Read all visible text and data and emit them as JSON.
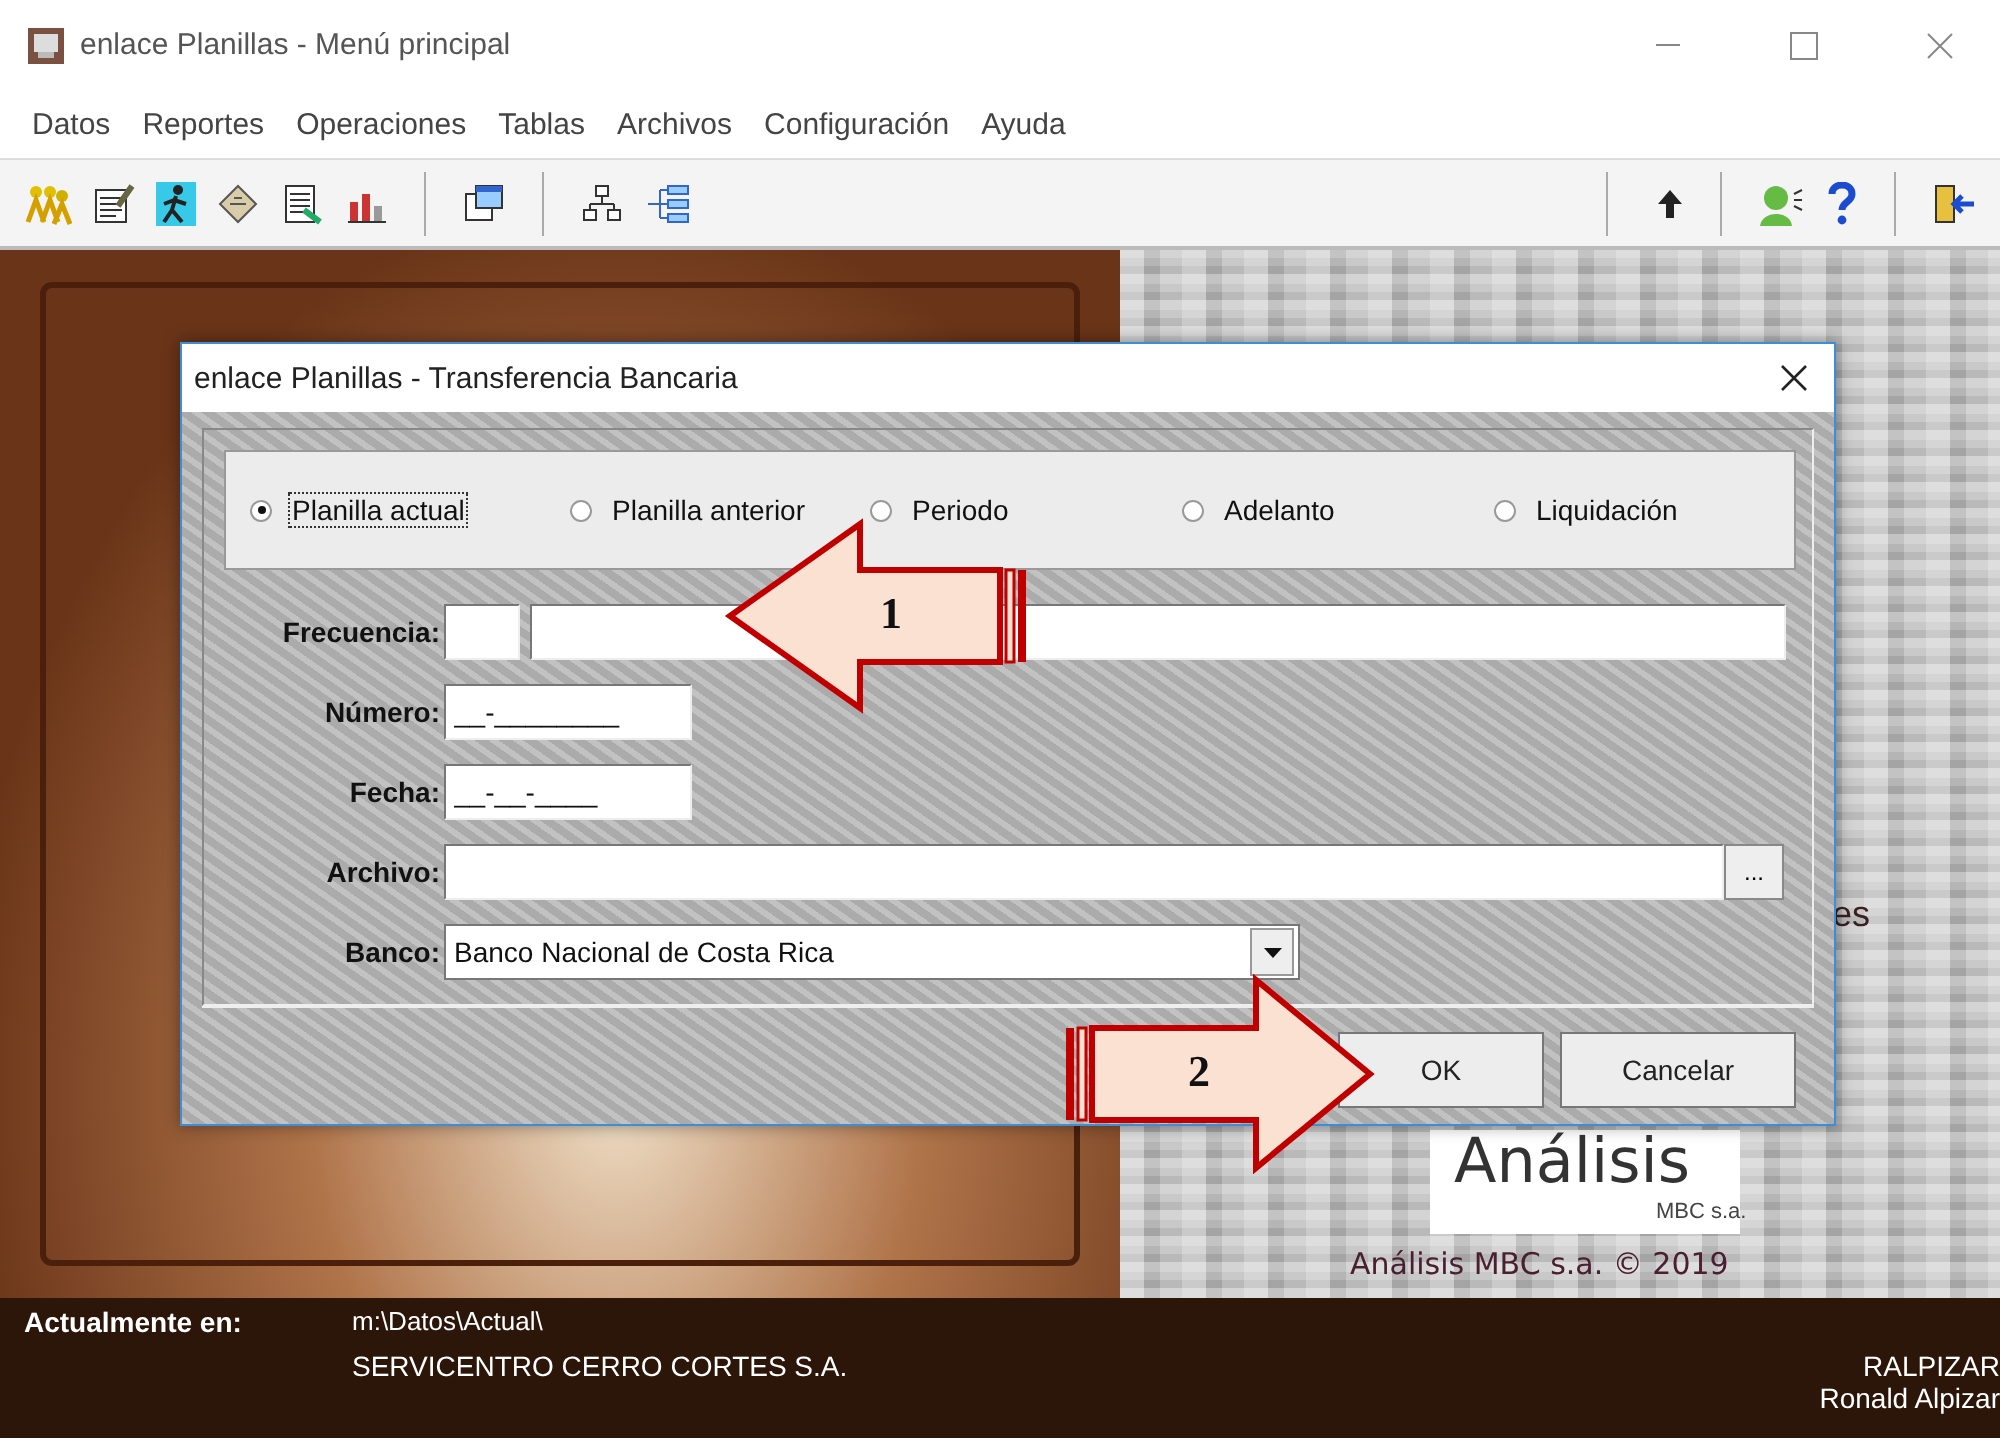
{
  "window": {
    "title": "enlace Planillas - Menú principal"
  },
  "menu": [
    "Datos",
    "Reportes",
    "Operaciones",
    "Tablas",
    "Archivos",
    "Configuración",
    "Ayuda"
  ],
  "background": {
    "fragment": "es",
    "logo_word": "Análisis",
    "logo_sub": "MBC s.a.",
    "copyright": "Análisis MBC s.a. © 2019"
  },
  "dialog": {
    "title": "enlace Planillas - Transferencia Bancaria",
    "options": [
      {
        "label": "Planilla actual",
        "selected": true
      },
      {
        "label": "Planilla anterior",
        "selected": false
      },
      {
        "label": "Periodo",
        "selected": false
      },
      {
        "label": "Adelanto",
        "selected": false
      },
      {
        "label": "Liquidación",
        "selected": false
      }
    ],
    "fields": [
      {
        "kind": "split",
        "label": "Frecuencia:"
      },
      {
        "kind": "masked",
        "label": "Número:",
        "value": "__-________"
      },
      {
        "kind": "masked",
        "label": "Fecha:",
        "value": "__-__-____"
      },
      {
        "kind": "browse",
        "label": "Archivo:",
        "button": "..."
      },
      {
        "kind": "combo",
        "label": "Banco:",
        "value": "Banco Nacional de Costa Rica"
      }
    ],
    "buttons": [
      "OK",
      "Cancelar"
    ]
  },
  "annotations": [
    {
      "kind": "arrow_left",
      "label": "1"
    },
    {
      "kind": "arrow_right",
      "label": "2"
    }
  ],
  "status_bar": {
    "label": "Actualmente en:",
    "path": "m:\\Datos\\Actual\\",
    "company": "SERVICENTRO CERRO CORTES S.A.",
    "user_code": "RALPIZAR",
    "user_name": "Ronald Alpizar"
  }
}
